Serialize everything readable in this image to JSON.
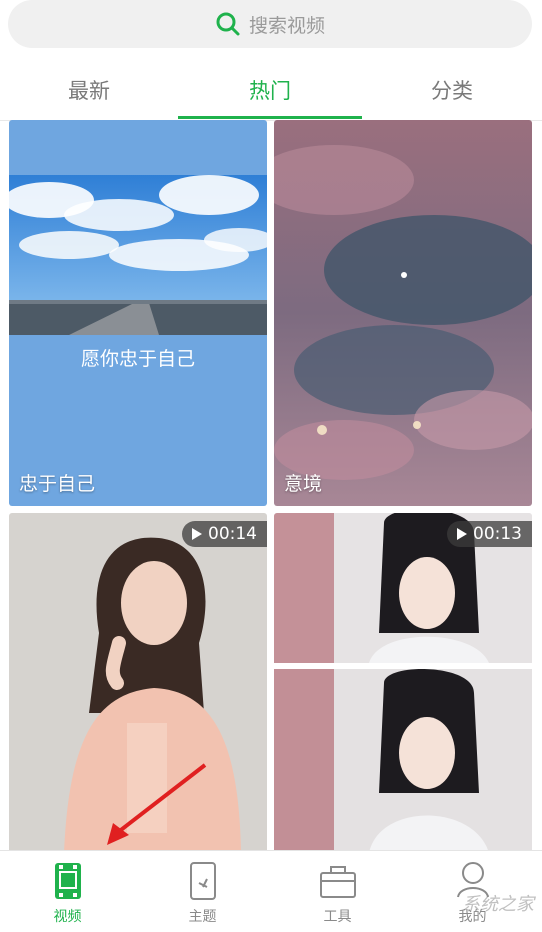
{
  "search": {
    "placeholder": "搜索视频"
  },
  "tabs": [
    {
      "label": "最新",
      "active": false
    },
    {
      "label": "热门",
      "active": true
    },
    {
      "label": "分类",
      "active": false
    }
  ],
  "cards": [
    {
      "title": "忠于自己",
      "caption": "愿你忠于自己",
      "duration": ""
    },
    {
      "title": "意境",
      "caption": "",
      "duration": ""
    },
    {
      "title": "",
      "caption": "",
      "duration": "00:14"
    },
    {
      "title": "",
      "caption": "",
      "duration": "00:13"
    }
  ],
  "nav": [
    {
      "label": "视频",
      "icon": "video-icon",
      "active": true
    },
    {
      "label": "主题",
      "icon": "theme-icon",
      "active": false
    },
    {
      "label": "工具",
      "icon": "toolbox-icon",
      "active": false
    },
    {
      "label": "我的",
      "icon": "profile-icon",
      "active": false
    }
  ],
  "watermark": "系统之家",
  "colors": {
    "accent": "#1fb24c",
    "card1_bg": "#6fa6e0",
    "card2_bg": "#9a7384"
  }
}
